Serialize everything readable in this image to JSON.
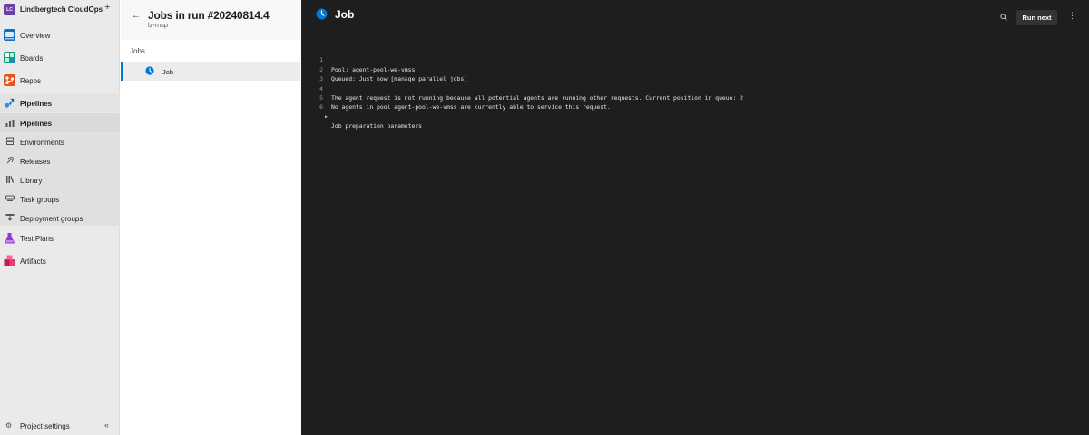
{
  "org": {
    "avatar": "LC",
    "name": "Lindbergtech CloudOps",
    "add": "+"
  },
  "nav": {
    "overview": "Overview",
    "boards": "Boards",
    "repos": "Repos",
    "pipelines_header": "Pipelines",
    "pipelines": "Pipelines",
    "environments": "Environments",
    "releases": "Releases",
    "library": "Library",
    "task_groups": "Task groups",
    "deployment_groups": "Deployment groups",
    "test_plans": "Test Plans",
    "artifacts": "Artifacts",
    "project_settings": "Project settings",
    "collapse": "«"
  },
  "jobs_panel": {
    "title": "Jobs in run #20240814.4",
    "subtitle": "lz-msp",
    "section_label": "Jobs",
    "jobs": [
      {
        "name": "Job",
        "status": "queued"
      }
    ]
  },
  "log": {
    "title": "Job",
    "run_next": "Run next",
    "lines": [
      {
        "n": "1",
        "prefix": "Pool: ",
        "link": "agent-pool-we-vmss",
        "suffix": ""
      },
      {
        "n": "2",
        "prefix": "Queued: Just now [",
        "link": "manage parallel jobs",
        "suffix": "]"
      },
      {
        "n": "3",
        "prefix": "",
        "link": "",
        "suffix": ""
      },
      {
        "n": "4",
        "prefix": "The agent request is not running because all potential agents are running other requests. Current position in queue: 2",
        "link": "",
        "suffix": ""
      },
      {
        "n": "5",
        "prefix": "No agents in pool agent-pool-we-vmss are currently able to service this request.",
        "link": "",
        "suffix": ""
      },
      {
        "n": "6",
        "prefix": "Job preparation parameters",
        "link": "",
        "suffix": "",
        "expandable": true
      }
    ]
  },
  "colors": {
    "accent": "#0078d4",
    "log_bg": "#1e1e1e",
    "nav_bg": "#eaeaea"
  },
  "icons": {
    "overview": "overview-icon",
    "boards": "boards-icon",
    "repos": "repos-icon",
    "pipelines": "pipelines-icon",
    "test_plans": "test-plans-icon",
    "artifacts": "artifacts-icon",
    "job_status": "clock-icon"
  }
}
